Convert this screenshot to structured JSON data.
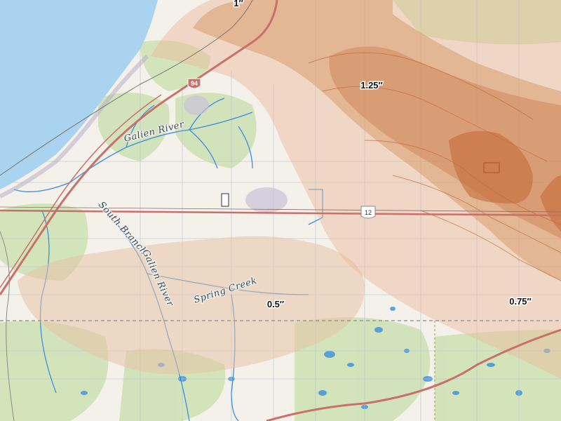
{
  "colors": {
    "lake": "#a9d3ef",
    "land": "#f4f1ea",
    "forest": "#cfe2b6",
    "water": "#3a8ee0",
    "road": "#c8706a",
    "band_low": "#f2d4bd",
    "band_mid": "#e8b58e",
    "band_high": "#d0804f",
    "contour_line": "#c26a3c"
  },
  "contours": [
    {
      "id": "c1",
      "label": "1″"
    },
    {
      "id": "c125",
      "label": "1.25″"
    },
    {
      "id": "c05",
      "label": "0.5″"
    },
    {
      "id": "c075",
      "label": "0.75″"
    }
  ],
  "rivers": [
    {
      "id": "galien",
      "label": "Galien River"
    },
    {
      "id": "south-branch-1",
      "label": "South Branch"
    },
    {
      "id": "south-branch-2",
      "label": "Galien River"
    },
    {
      "id": "spring-creek",
      "label": "Spring Creek"
    }
  ],
  "shields": [
    {
      "id": "i94",
      "label": "94"
    },
    {
      "id": "us12",
      "label": "12"
    }
  ]
}
